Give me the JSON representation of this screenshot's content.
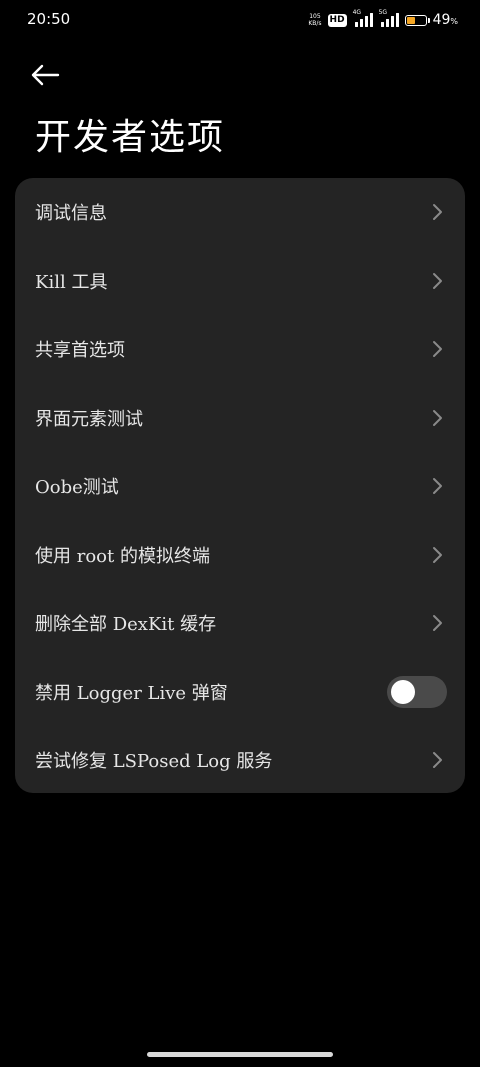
{
  "status_bar": {
    "time": "20:50",
    "net_speed_value": "105",
    "net_speed_unit": "KB/s",
    "hd_label": "HD",
    "signal1_label": "4G",
    "signal2_label": "5G",
    "battery_level": 0.49,
    "battery_percent": "49",
    "battery_unit": "%",
    "battery_color": "#F5A623"
  },
  "header": {
    "back_icon": "arrow-left-icon",
    "title": "开发者选项"
  },
  "settings": {
    "items": [
      {
        "label": "调试信息",
        "control": "chevron"
      },
      {
        "label": "Kill 工具",
        "control": "chevron"
      },
      {
        "label": "共享首选项",
        "control": "chevron"
      },
      {
        "label": "界面元素测试",
        "control": "chevron"
      },
      {
        "label": "Oobe测试",
        "control": "chevron"
      },
      {
        "label": "使用 root 的模拟终端",
        "control": "chevron"
      },
      {
        "label": "删除全部 DexKit 缓存",
        "control": "chevron"
      },
      {
        "label": "禁用 Logger Live 弹窗",
        "control": "toggle",
        "toggle_on": false
      },
      {
        "label": "尝试修复 LSPosed Log 服务",
        "control": "chevron"
      }
    ]
  },
  "colors": {
    "background": "#000000",
    "card": "#242424",
    "text": "#e6e6e6",
    "chevron": "#8a8a8a",
    "toggle_track": "#4a4a4a"
  }
}
